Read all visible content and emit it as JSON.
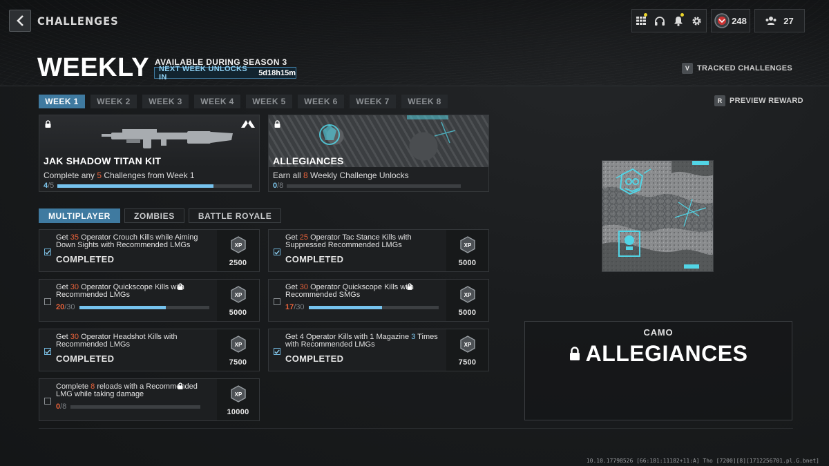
{
  "header": {
    "breadcrumb": "CHALLENGES",
    "title": "WEEKLY",
    "season_text": "AVAILABLE DURING SEASON 3",
    "unlock_label": "NEXT WEEK UNLOCKS IN",
    "unlock_time": "5d18h15m",
    "tracked_key": "V",
    "tracked_label": "TRACKED CHALLENGES",
    "preview_key": "R",
    "preview_label": "PREVIEW REWARD",
    "player_level": "248",
    "party_count": "27"
  },
  "week_tabs": [
    "WEEK 1",
    "WEEK 2",
    "WEEK 3",
    "WEEK 4",
    "WEEK 5",
    "WEEK 6",
    "WEEK 7",
    "WEEK 8"
  ],
  "active_week_index": 0,
  "rewards": [
    {
      "name": "JAK SHADOW TITAN KIT",
      "desc_pre": "Complete any ",
      "desc_num": "5",
      "desc_post": " Challenges from Week 1",
      "progress_current": "4",
      "progress_total": "/5",
      "progress_fraction": 0.8
    },
    {
      "name": "ALLEGIANCES",
      "desc_pre": "Earn all ",
      "desc_num": "8",
      "desc_post": " Weekly Challenge Unlocks",
      "progress_current": "0",
      "progress_total": "/8",
      "progress_fraction": 0.0
    }
  ],
  "mode_tabs": [
    "MULTIPLAYER",
    "ZOMBIES",
    "BATTLE ROYALE"
  ],
  "active_mode_index": 0,
  "challenges": [
    {
      "parts": [
        [
          "Get ",
          ""
        ],
        [
          "35",
          "hl"
        ],
        [
          " Operator Crouch Kills while Aiming Down Sights with Recommended LMGs",
          ""
        ]
      ],
      "completed": true,
      "status": "COMPLETED",
      "xp": "2500",
      "locked": false
    },
    {
      "parts": [
        [
          "Get ",
          ""
        ],
        [
          "25",
          "hl"
        ],
        [
          " Operator Tac Stance Kills with Suppressed Recommended LMGs",
          ""
        ]
      ],
      "completed": true,
      "status": "COMPLETED",
      "xp": "5000",
      "locked": false
    },
    {
      "parts": [
        [
          "Get ",
          ""
        ],
        [
          "30",
          "hl"
        ],
        [
          " Operator Quickscope Kills with Recommended LMGs",
          ""
        ]
      ],
      "completed": false,
      "progress_current": "20",
      "progress_total": "/30",
      "progress_fraction": 0.667,
      "xp": "5000",
      "locked": true
    },
    {
      "parts": [
        [
          "Get ",
          ""
        ],
        [
          "30",
          "hl"
        ],
        [
          " Operator Quickscope Kills with Recommended SMGs",
          ""
        ]
      ],
      "completed": false,
      "progress_current": "17",
      "progress_total": "/30",
      "progress_fraction": 0.567,
      "xp": "5000",
      "locked": true
    },
    {
      "parts": [
        [
          "Get ",
          ""
        ],
        [
          "30",
          "hl"
        ],
        [
          " Operator Headshot Kills with Recommended LMGs",
          ""
        ]
      ],
      "completed": true,
      "status": "COMPLETED",
      "xp": "7500",
      "locked": false
    },
    {
      "parts": [
        [
          "Get 4 Operator Kills with 1 Magazine ",
          ""
        ],
        [
          "3",
          "blu"
        ],
        [
          " Times with Recommended LMGs",
          ""
        ]
      ],
      "completed": true,
      "status": "COMPLETED",
      "xp": "7500",
      "locked": false
    },
    {
      "parts": [
        [
          "Complete ",
          ""
        ],
        [
          "8",
          "hl"
        ],
        [
          " reloads with a Recommended LMG while taking damage",
          ""
        ]
      ],
      "completed": false,
      "progress_current": "0",
      "progress_total": "/8",
      "progress_fraction": 0.0,
      "xp": "10000",
      "locked": true
    }
  ],
  "camo": {
    "type": "CAMO",
    "name": "ALLEGIANCES"
  },
  "build_string": "10.10.17798526 [66:181:11182+11:A] Tho [7200][8][1712256701.pl.G.bnet]",
  "colors": {
    "accent_blue": "#3f7aa0",
    "progress_blue": "#76c3ee",
    "highlight_orange": "#e8623a",
    "camo_cyan": "#52d5e6"
  }
}
